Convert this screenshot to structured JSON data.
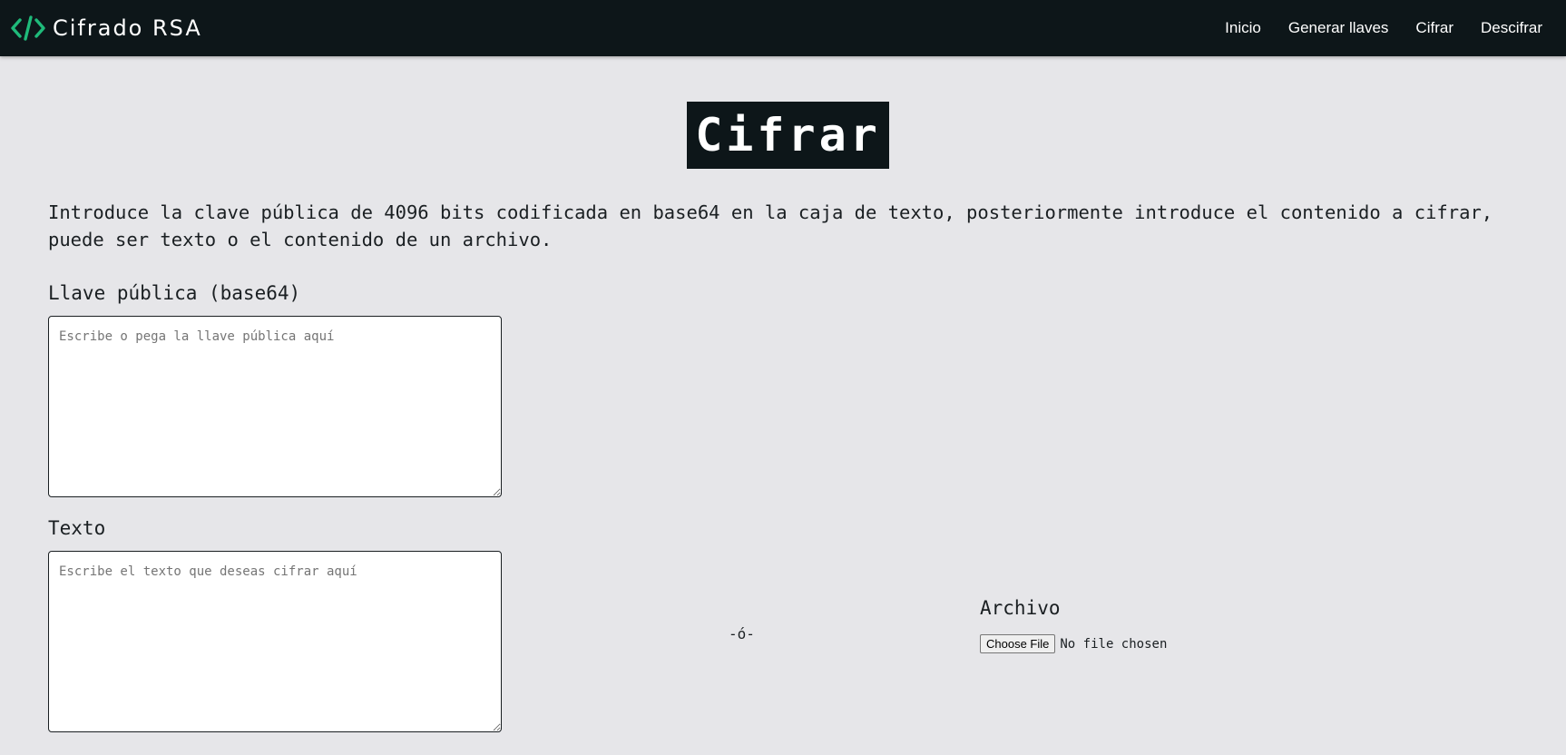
{
  "navbar": {
    "brand_title": "Cifrado RSA",
    "brand_icon": "code-icon",
    "brand_color": "#1fba7a",
    "links": [
      "Inicio",
      "Generar llaves",
      "Cifrar",
      "Descifrar"
    ]
  },
  "main": {
    "title": "Cifrar",
    "intro": "Introduce la clave pública de 4096 bits codificada en base64 en la caja de texto, posteriormente introduce el contenido a cifrar, puede ser texto o el contenido de un archivo.",
    "public_key": {
      "label": "Llave pública (base64)",
      "placeholder": "Escribe o pega la llave pública aquí",
      "value": ""
    },
    "text": {
      "label": "Texto",
      "placeholder": "Escribe el texto que deseas cifrar aquí",
      "value": ""
    },
    "separator": "-ó-",
    "file": {
      "label": "Archivo",
      "button_label": "Choose File",
      "status": "No file chosen"
    }
  }
}
